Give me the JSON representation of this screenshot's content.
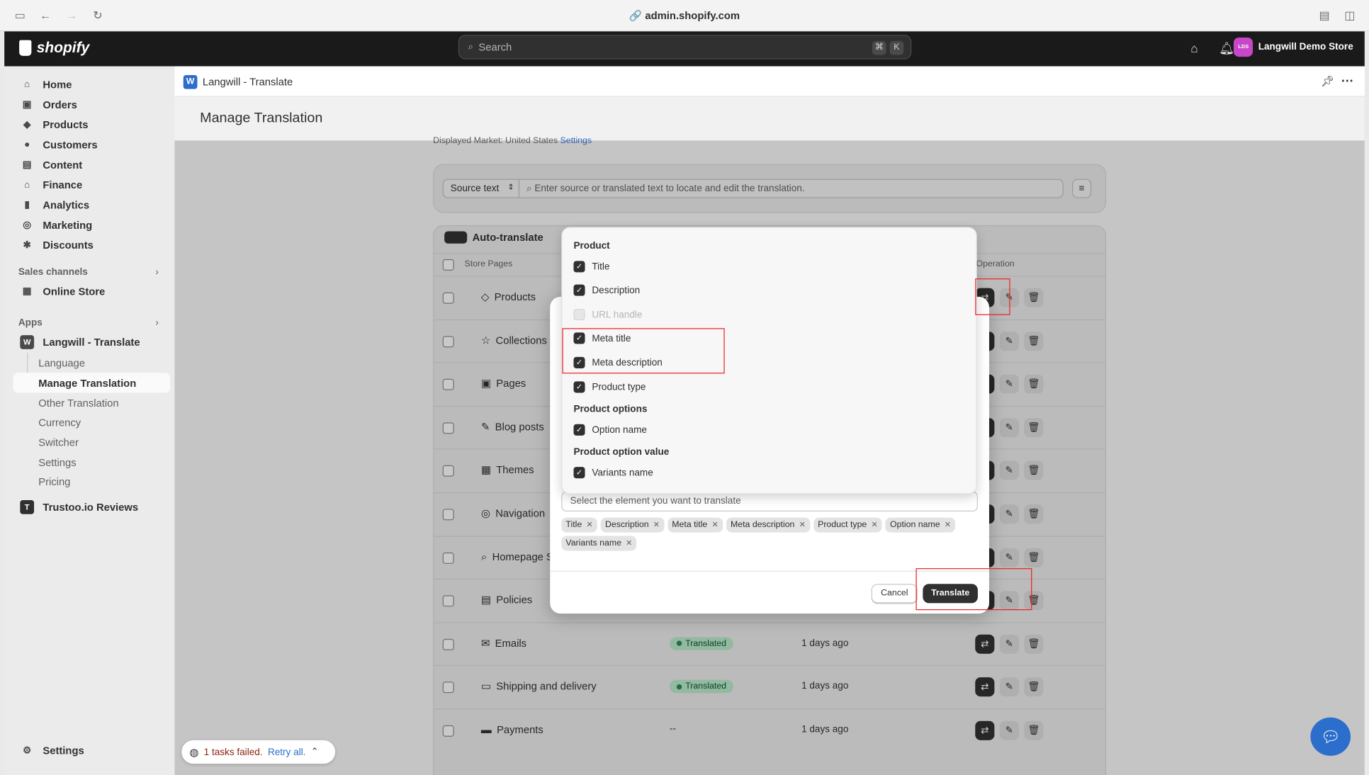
{
  "browser": {
    "url": "admin.shopify.com"
  },
  "topbar": {
    "brand": "shopify",
    "search_placeholder": "Search",
    "kbd_cmd": "⌘",
    "kbd_k": "K",
    "store_initials": "LDS",
    "store_name": "Langwill Demo Store"
  },
  "sidebar": {
    "items": [
      "Home",
      "Orders",
      "Products",
      "Customers",
      "Content",
      "Finance",
      "Analytics",
      "Marketing",
      "Discounts"
    ],
    "sales_channels_label": "Sales channels",
    "online_store": "Online Store",
    "apps_label": "Apps",
    "app_name": "Langwill - Translate",
    "app_sub": [
      "Language",
      "Manage Translation",
      "Other Translation",
      "Currency",
      "Switcher",
      "Settings",
      "Pricing"
    ],
    "trustoo": "Trustoo.io Reviews",
    "settings": "Settings"
  },
  "app": {
    "title": "Langwill - Translate",
    "page_title": "Manage Translation"
  },
  "filter": {
    "market_text": "Displayed Market: United States",
    "market_link": "Settings",
    "source_select": "Source text",
    "search_placeholder": "Enter source or translated text to locate and edit the translation."
  },
  "table": {
    "auto_translate": "Auto-translate",
    "col_store_pages": "Store Pages",
    "col_operation": "Operation",
    "rows": [
      {
        "name": "Products",
        "status": "",
        "date": ""
      },
      {
        "name": "Collections",
        "status": "",
        "date": ""
      },
      {
        "name": "Pages",
        "status": "",
        "date": ""
      },
      {
        "name": "Blog posts",
        "status": "",
        "date": ""
      },
      {
        "name": "Themes",
        "status": "",
        "date": ""
      },
      {
        "name": "Navigation",
        "status": "",
        "date": ""
      },
      {
        "name": "Homepage SEO",
        "status": "",
        "date": ""
      },
      {
        "name": "Policies",
        "status": "",
        "date": ""
      },
      {
        "name": "Emails",
        "status": "Translated",
        "date": "1 days ago"
      },
      {
        "name": "Shipping and delivery",
        "status": "Translated",
        "date": "1 days ago"
      },
      {
        "name": "Payments",
        "status": "--",
        "date": "1 days ago"
      }
    ]
  },
  "dropdown": {
    "group_product": "Product",
    "product_options_group": [
      "Title",
      "Description",
      "URL handle",
      "Meta title",
      "Meta description",
      "Product type"
    ],
    "group_options": "Product options",
    "option_name": "Option name",
    "group_option_value": "Product option value",
    "variants_name": "Variants name"
  },
  "modal": {
    "select_placeholder": "Select the element you want to translate",
    "tags": [
      "Title",
      "Description",
      "Meta title",
      "Meta description",
      "Product type",
      "Option name",
      "Variants name"
    ],
    "cancel": "Cancel",
    "translate": "Translate"
  },
  "toast": {
    "failed": "1 tasks failed.",
    "retry": "Retry all."
  }
}
